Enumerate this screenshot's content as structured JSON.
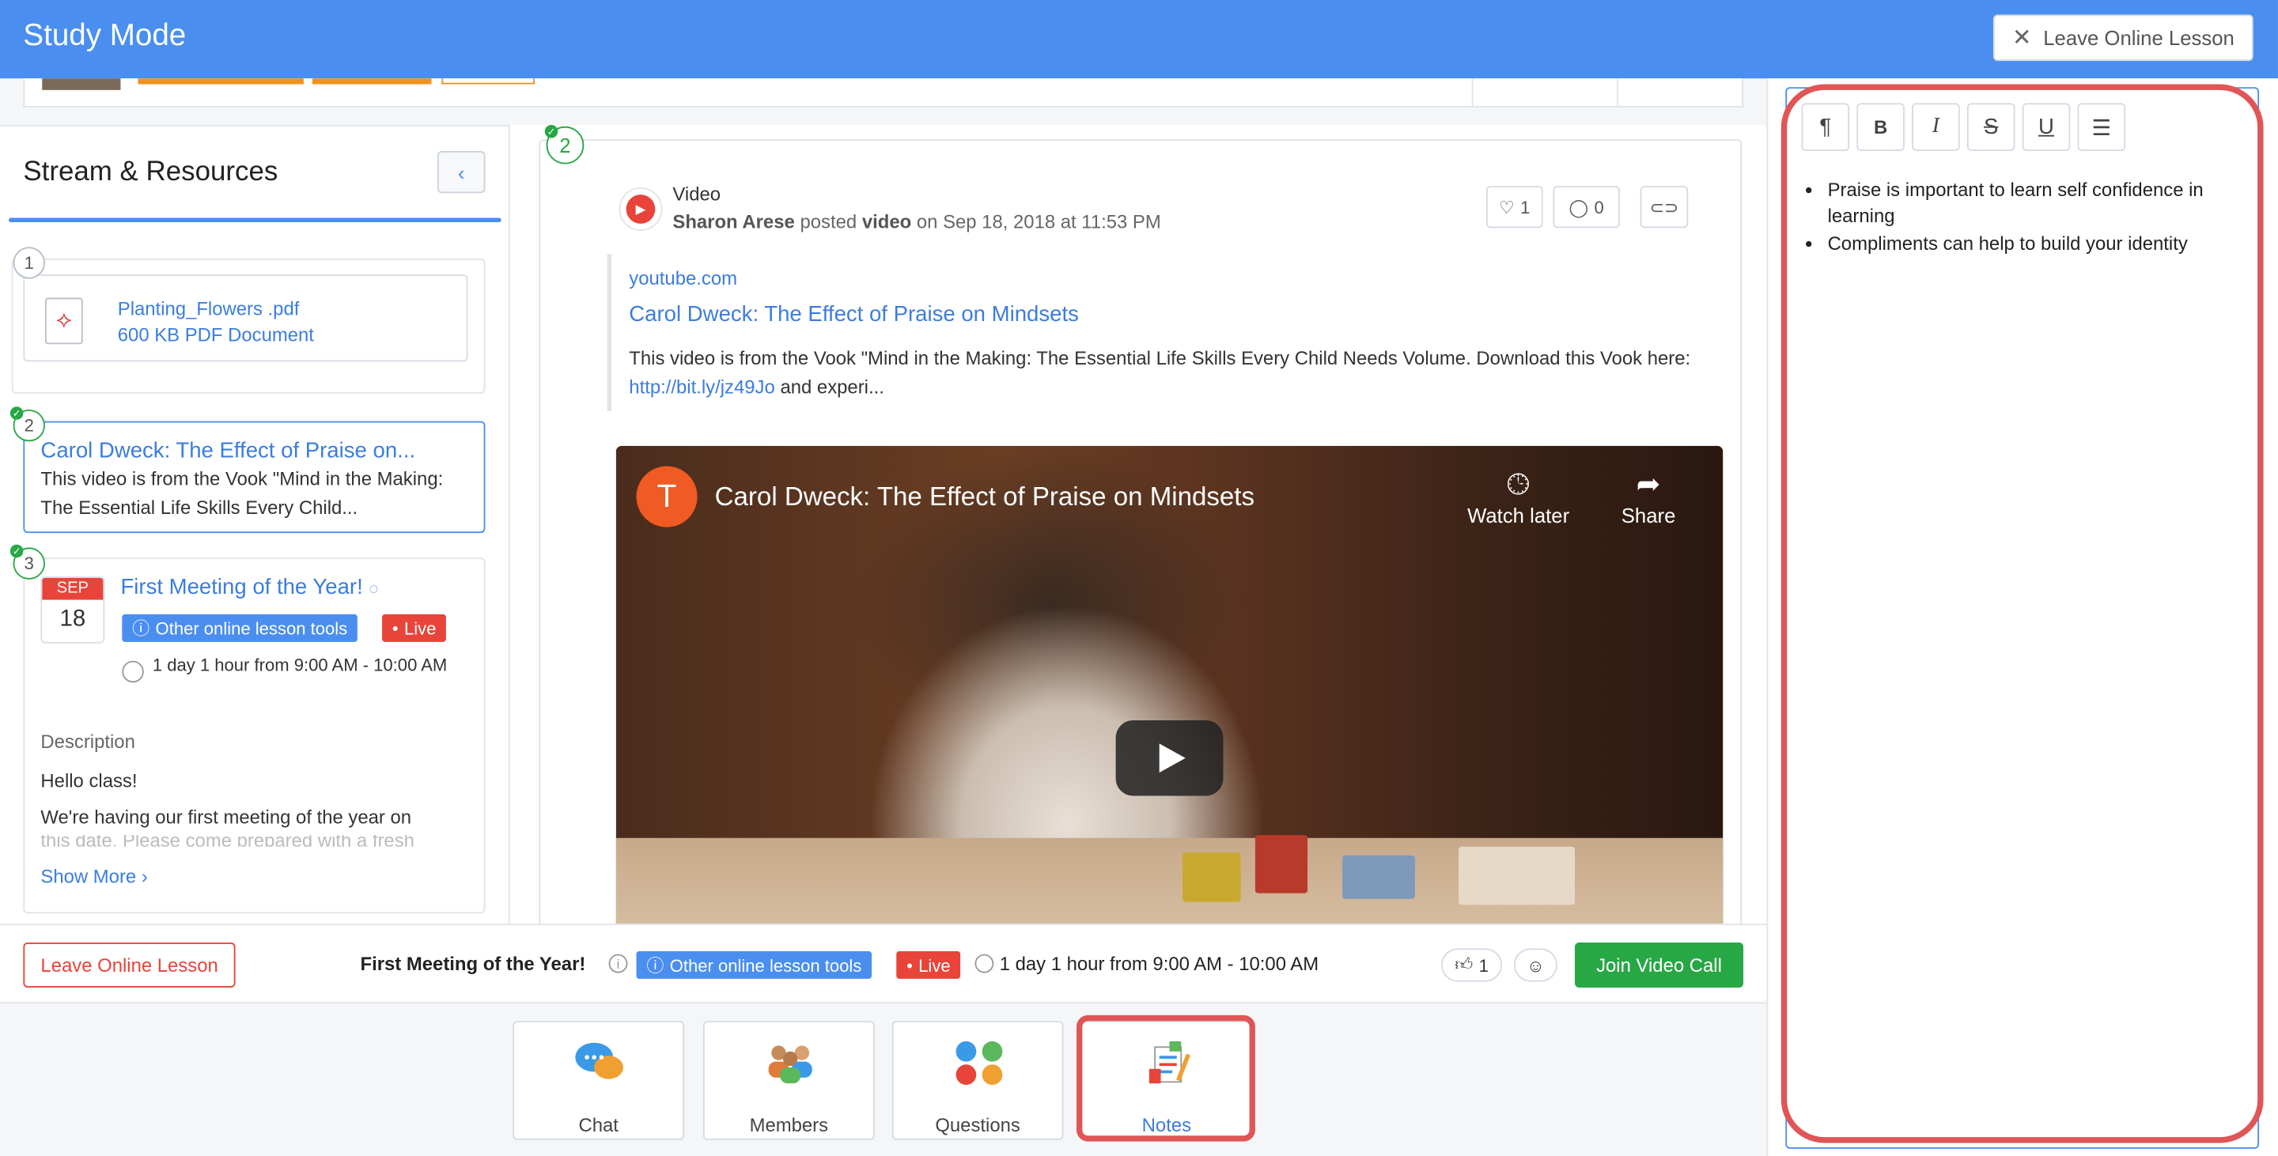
{
  "app": {
    "title": "Study Mode",
    "leave_top": "Leave Online Lesson"
  },
  "left": {
    "header": "Stream & Resources",
    "items": [
      {
        "num": "1",
        "file_name": "Planting_Flowers .pdf",
        "file_meta": "600 KB PDF Document"
      },
      {
        "num": "2",
        "title": "Carol Dweck: The Effect of Praise on...",
        "desc": "This video is from the Vook \"Mind in the Making: The Essential Life Skills Every Child..."
      },
      {
        "num": "3",
        "cal_month": "SEP",
        "cal_day": "18",
        "title": "First Meeting of the Year!",
        "badge_tools": "Other online lesson tools",
        "badge_live": "Live",
        "time": "1 day 1 hour from 9:00 AM - 10:00 AM",
        "desc_label": "Description",
        "desc_line1": "Hello class!",
        "desc_line2": "We're having our first meeting of the year on",
        "desc_line3": "this date. Please come prepared with a fresh",
        "show_more": "Show More"
      }
    ]
  },
  "post": {
    "num": "2",
    "type": "Video",
    "author": "Sharon Arese",
    "posted": "posted",
    "kind": "video",
    "date": "on Sep 18, 2018 at 11:53 PM",
    "likes": "1",
    "comments": "0",
    "domain": "youtube.com",
    "link_title": "Carol Dweck: The Effect of Praise on Mindsets",
    "text_a": "This video is from the Vook \"Mind in the Making: The Essential Life Skills Every Child Needs Volume. Download this Vook",
    "text_b": "here:",
    "text_link": "http://bit.ly/jz49Jo",
    "text_c": "and experi...",
    "video": {
      "avatar": "T",
      "title": "Carol Dweck: The Effect of Praise on Mindsets",
      "watch_later": "Watch later",
      "share": "Share"
    }
  },
  "lessonbar": {
    "leave": "Leave Online Lesson",
    "title": "First Meeting of the Year!",
    "badge_tools": "Other online lesson tools",
    "badge_live": "Live",
    "time": "1 day 1 hour from 9:00 AM - 10:00 AM",
    "likes": "1",
    "join": "Join Video Call"
  },
  "tools": [
    {
      "label": "Chat"
    },
    {
      "label": "Members"
    },
    {
      "label": "Questions"
    },
    {
      "label": "Notes"
    }
  ],
  "notes": {
    "items": [
      "Praise is important to learn self confidence in learning",
      "Compliments can help to build your identity"
    ]
  },
  "colors": {
    "brand": "#4a8ef0",
    "live": "#e8443a",
    "join": "#28a745",
    "highlight": "#e05555"
  }
}
